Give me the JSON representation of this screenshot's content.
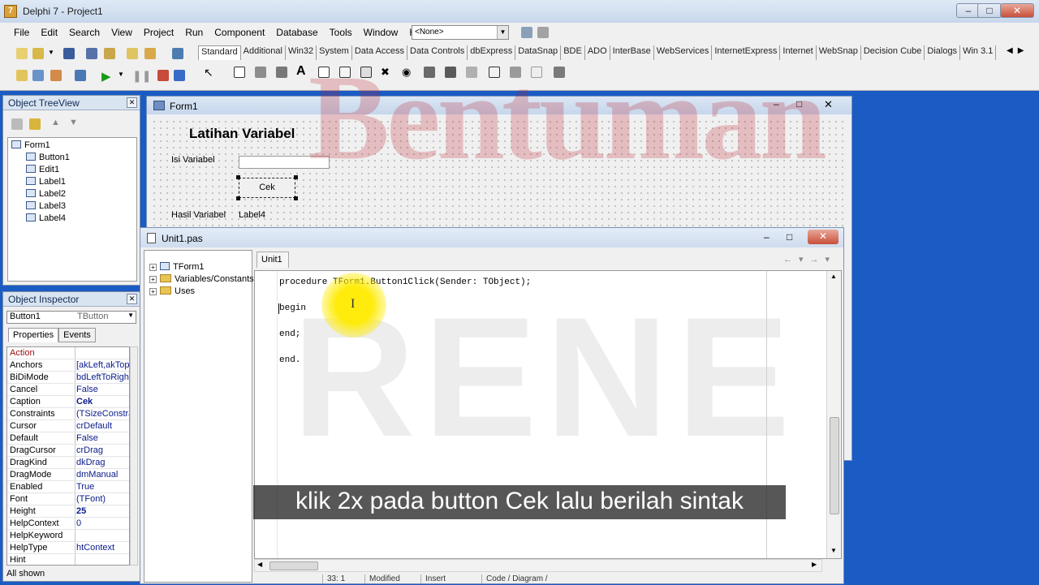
{
  "ide": {
    "title": "Delphi 7 - Project1",
    "menu": [
      "File",
      "Edit",
      "Search",
      "View",
      "Project",
      "Run",
      "Component",
      "Database",
      "Tools",
      "Window",
      "Help"
    ],
    "config_combo": "<None>",
    "palette_tabs": [
      "Standard",
      "Additional",
      "Win32",
      "System",
      "Data Access",
      "Data Controls",
      "dbExpress",
      "DataSnap",
      "BDE",
      "ADO",
      "InterBase",
      "WebServices",
      "InternetExpress",
      "Internet",
      "WebSnap",
      "Decision Cube",
      "Dialogs",
      "Win 3.1"
    ],
    "active_palette_tab": "Standard"
  },
  "treeview": {
    "title": "Object TreeView",
    "nodes": [
      "Form1",
      "Button1",
      "Edit1",
      "Label1",
      "Label2",
      "Label3",
      "Label4"
    ]
  },
  "inspector": {
    "title": "Object Inspector",
    "selected_object": "Button1",
    "selected_type": "TButton",
    "tabs": [
      "Properties",
      "Events"
    ],
    "properties": [
      {
        "name": "Action",
        "value": ""
      },
      {
        "name": "Anchors",
        "value": "[akLeft,akTop]"
      },
      {
        "name": "BiDiMode",
        "value": "bdLeftToRight"
      },
      {
        "name": "Cancel",
        "value": "False"
      },
      {
        "name": "Caption",
        "value": "Cek"
      },
      {
        "name": "Constraints",
        "value": "(TSizeConstraints)"
      },
      {
        "name": "Cursor",
        "value": "crDefault"
      },
      {
        "name": "Default",
        "value": "False"
      },
      {
        "name": "DragCursor",
        "value": "crDrag"
      },
      {
        "name": "DragKind",
        "value": "dkDrag"
      },
      {
        "name": "DragMode",
        "value": "dmManual"
      },
      {
        "name": "Enabled",
        "value": "True"
      },
      {
        "name": "Font",
        "value": "(TFont)"
      },
      {
        "name": "Height",
        "value": "25"
      },
      {
        "name": "HelpContext",
        "value": "0"
      },
      {
        "name": "HelpKeyword",
        "value": ""
      },
      {
        "name": "HelpType",
        "value": "htContext"
      },
      {
        "name": "Hint",
        "value": ""
      }
    ],
    "status": "All shown"
  },
  "form1": {
    "title": "Form1",
    "heading": "Latihan Variabel",
    "label_input": "Isi Variabel",
    "button_caption": "Cek",
    "label_result": "Hasil Variabel",
    "label4": "Label4"
  },
  "editor": {
    "title": "Unit1.pas",
    "tab": "Unit1",
    "explorer": [
      "TForm1",
      "Variables/Constants",
      "Uses"
    ],
    "code_lines": [
      "procedure TForm1.Button1Click(Sender: TObject);",
      "begin",
      "end;",
      "end."
    ],
    "status": {
      "position": "33: 1",
      "modified": "Modified",
      "mode": "Insert",
      "views": "Code / Diagram /"
    }
  },
  "overlay": {
    "watermark_top": "Bentuman",
    "watermark_bottom": "RENE",
    "subtitle": "klik 2x pada button Cek lalu berilah sintak"
  },
  "colors": {
    "desktop": "#1a5bc4",
    "highlight": "#ffeb00",
    "prop_value": "#0a1b8a"
  }
}
